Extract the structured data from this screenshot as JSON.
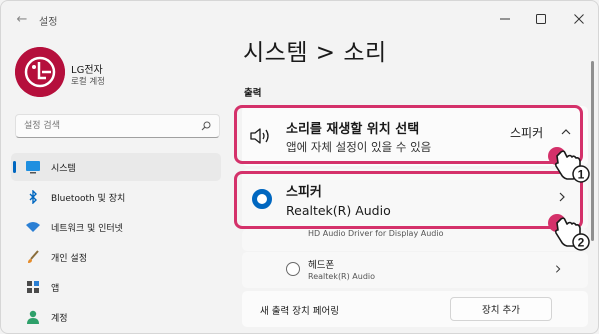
{
  "window": {
    "app_title": "설정",
    "back_glyph": "←"
  },
  "profile": {
    "name": "LG전자",
    "account_type": "로컬 계정"
  },
  "search": {
    "placeholder": "설정 검색"
  },
  "sidebar": {
    "items": [
      {
        "label": "시스템",
        "icon": "monitor-icon",
        "active": true
      },
      {
        "label": "Bluetooth 및 장치",
        "icon": "bluetooth-icon",
        "active": false
      },
      {
        "label": "네트워크 및 인터넷",
        "icon": "wifi-icon",
        "active": false
      },
      {
        "label": "개인 설정",
        "icon": "brush-icon",
        "active": false
      },
      {
        "label": "앱",
        "icon": "apps-icon",
        "active": false
      },
      {
        "label": "계정",
        "icon": "account-icon",
        "active": false
      }
    ]
  },
  "main": {
    "breadcrumb": "시스템  >  소리",
    "section_output": "출력",
    "output_select": {
      "title": "소리를 재생할 위치 선택",
      "subtitle": "앱에 자체 설정이 있을 수 있음",
      "value": "스피커"
    },
    "devices": [
      {
        "name": "스피커",
        "detail": "Realtek(R) Audio",
        "selected": true
      },
      {
        "name": "헤드폰",
        "detail": "Realtek(R) Audio",
        "selected": false
      }
    ],
    "hdmi_text": "HD Audio Driver for Display Audio",
    "pair_label": "새 출력 장치 페어링",
    "pair_button": "장치 추가"
  },
  "annotations": {
    "step1": "1",
    "step2": "2",
    "highlight_color": "#d4316a"
  },
  "colors": {
    "accent": "#0067c0",
    "brand": "#b50f3c"
  }
}
